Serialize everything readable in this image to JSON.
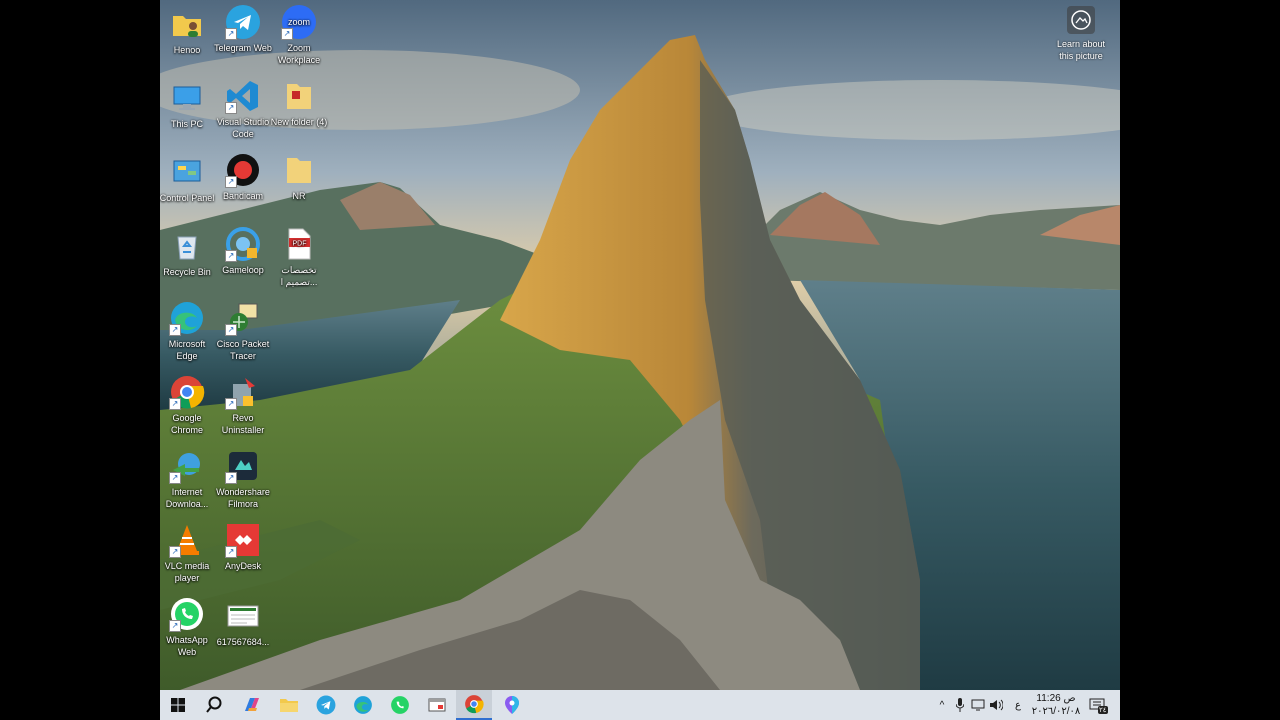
{
  "desktop": {
    "icons": [
      {
        "label": "Henoo",
        "icon": "folder-user-icon"
      },
      {
        "label": "Telegram Web",
        "icon": "telegram-icon"
      },
      {
        "label": "Zoom Workplace",
        "icon": "zoom-icon",
        "badge_text": "zoom"
      },
      {
        "label": "This PC",
        "icon": "computer-icon"
      },
      {
        "label": "Visual Studio Code",
        "icon": "vscode-icon"
      },
      {
        "label": "New folder (4)",
        "icon": "folder-icon"
      },
      {
        "label": "Control Panel",
        "icon": "control-panel-icon"
      },
      {
        "label": "Bandicam",
        "icon": "bandicam-icon"
      },
      {
        "label": "NR",
        "icon": "folder-icon"
      },
      {
        "label": "Recycle Bin",
        "icon": "recycle-bin-icon"
      },
      {
        "label": "Gameloop",
        "icon": "gameloop-icon"
      },
      {
        "label": "تخصصات تصميم ا...",
        "icon": "pdf-file-icon",
        "badge_text": "PDF"
      },
      {
        "label": "Microsoft Edge",
        "icon": "edge-icon"
      },
      {
        "label": "Cisco Packet Tracer",
        "icon": "cisco-packet-tracer-icon"
      },
      {
        "label": "Google Chrome",
        "icon": "chrome-icon"
      },
      {
        "label": "Revo Uninstaller",
        "icon": "revo-uninstaller-icon"
      },
      {
        "label": "Internet Downloa...",
        "icon": "internet-download-manager-icon"
      },
      {
        "label": "Wondershare Filmora",
        "icon": "filmora-icon"
      },
      {
        "label": "VLC media player",
        "icon": "vlc-icon"
      },
      {
        "label": "AnyDesk",
        "icon": "anydesk-icon"
      },
      {
        "label": "WhatsApp Web",
        "icon": "whatsapp-icon"
      },
      {
        "label": "617567684...",
        "icon": "document-thumbnail-icon"
      }
    ],
    "learn_about": {
      "label": "Learn about this picture",
      "icon": "camera-icon"
    }
  },
  "taskbar": {
    "buttons": [
      {
        "name": "start-button",
        "icon": "windows-logo-icon"
      },
      {
        "name": "search-button",
        "icon": "search-icon"
      },
      {
        "name": "copilot-button",
        "icon": "copilot-icon"
      },
      {
        "name": "file-explorer-button",
        "icon": "folder-icon"
      },
      {
        "name": "telegram-button",
        "icon": "telegram-icon"
      },
      {
        "name": "edge-button",
        "icon": "edge-icon"
      },
      {
        "name": "whatsapp-button",
        "icon": "whatsapp-icon"
      },
      {
        "name": "app-window-button",
        "icon": "window-icon"
      },
      {
        "name": "chrome-button",
        "icon": "chrome-icon",
        "active": true
      },
      {
        "name": "maps-button",
        "icon": "location-pin-icon"
      }
    ],
    "tray": {
      "chevron": "^",
      "language": "ع",
      "time": "11:26 ص",
      "date": "٢٠٢٦/٠٢/٠٨",
      "notification_count": "٢٤"
    }
  }
}
